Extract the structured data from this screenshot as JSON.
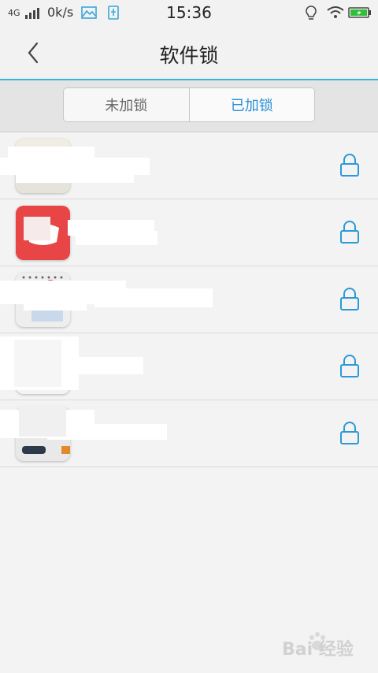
{
  "status_bar": {
    "network": "4G",
    "speed": "0k/s",
    "time": "15:36",
    "icons": [
      "signal-icon",
      "image-notification-icon",
      "usb-icon",
      "bulb-icon",
      "wifi-icon",
      "battery-icon"
    ],
    "battery_color": "#2fbf3a"
  },
  "header": {
    "title": "软件锁",
    "back_icon": "chevron-left-icon"
  },
  "tabs": [
    {
      "label": "未加锁",
      "selected": false
    },
    {
      "label": "已加锁",
      "selected": true
    }
  ],
  "accent_color": "#2a8fd6",
  "apps": [
    {
      "name": "",
      "lock_icon": "lock-icon",
      "icon_color": "#f1ede2"
    },
    {
      "name": "",
      "lock_icon": "lock-icon",
      "icon_color": "#e84646"
    },
    {
      "name": "",
      "lock_icon": "lock-icon",
      "icon_color": "#eeeeee"
    },
    {
      "name": "",
      "lock_icon": "lock-icon",
      "icon_color": "#f4f4f4"
    },
    {
      "name": "",
      "lock_icon": "lock-icon",
      "icon_color": "#e9e9e9"
    }
  ],
  "watermark": {
    "text": "Bai 经验",
    "icon": "baidu-paw-icon"
  }
}
